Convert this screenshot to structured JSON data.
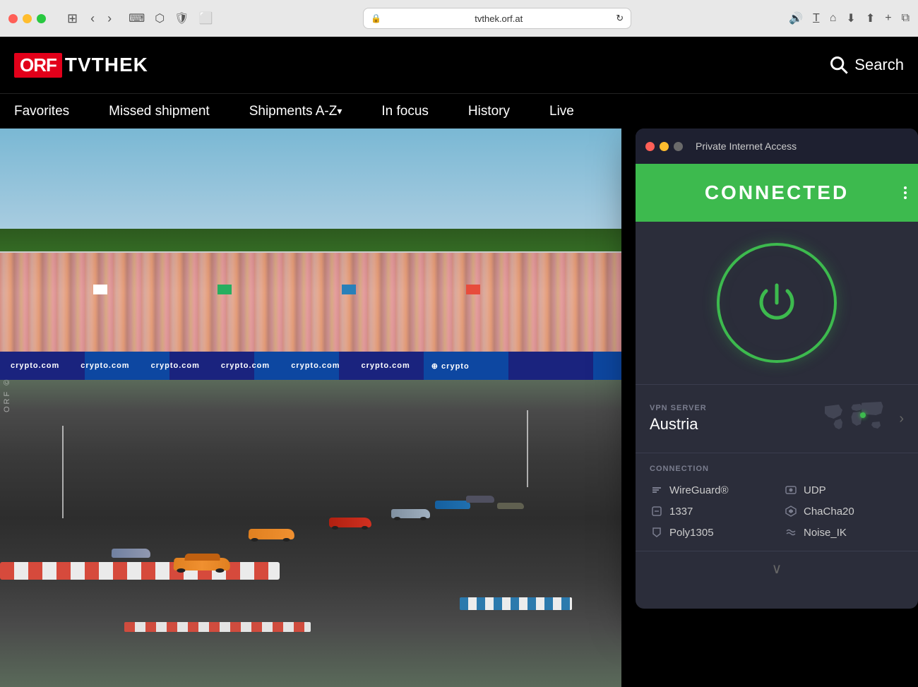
{
  "browser": {
    "title": "tvthek.orf.at",
    "traffic_lights": [
      "red",
      "yellow",
      "green"
    ],
    "url": "tvthek.orf.at",
    "lock_symbol": "🔒"
  },
  "orf": {
    "logo_orf": "ORF",
    "logo_tvthek": "TVTHEK",
    "search_label": "Search",
    "nav": {
      "favorites": "Favorites",
      "missed": "Missed shipment",
      "shipments": "Shipments A-Z",
      "in_focus": "In focus",
      "history": "History",
      "live": "Live"
    }
  },
  "pia": {
    "title": "Private Internet Access",
    "connected": "CONNECTED",
    "server_label": "VPN SERVER",
    "server_name": "Austria",
    "connection_label": "CONNECTION",
    "connection": {
      "protocol": "WireGuard®",
      "port": "1337",
      "encryption": "Poly1305",
      "transport": "UDP",
      "cipher": "ChaCha20",
      "handshake": "Noise_IK"
    },
    "chevron_down": "∨"
  }
}
